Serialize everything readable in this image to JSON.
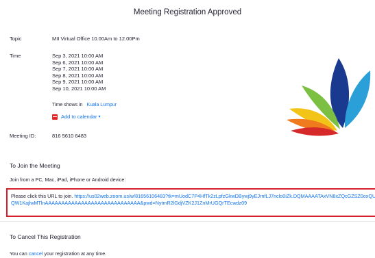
{
  "header": {
    "title": "Meeting Registration Approved"
  },
  "topic": {
    "label": "Topic",
    "value": "MII Virtual Office 10.00Am to 12.00Pm"
  },
  "time": {
    "label": "Time",
    "slots": [
      "Sep 3, 2021 10:00 AM",
      "Sep 6, 2021 10:00 AM",
      "Sep 7, 2021 10:00 AM",
      "Sep 8, 2021 10:00 AM",
      "Sep 9, 2021 10:00 AM",
      "Sep 10, 2021 10:00 AM"
    ],
    "timezone_prefix": "Time shows in",
    "timezone": "Kuala Lumpur",
    "add_calendar": "Add to calendar"
  },
  "meeting_id": {
    "label": "Meeting ID:",
    "value": "816 5610 6483"
  },
  "join": {
    "heading": "To Join the Meeting",
    "subtext": "Join from a PC, Mac, iPad, iPhone or Android device:",
    "url_prefix": "Please click this URL to join.",
    "url": "https://us02web.zoom.us/w/81656106483?tk=mUodC7P4HfTk2zLpfzGkwDBywj9yEJrnfLJ7nclo0iZk.DQMAAAATAxVN8xZQcGZSZ0oxQUwYUhmQW1KajlwMTlnAAAAAAAAAAAAAAAAAAAAAAAAAAAAA&pwd=NytmR2lGdjVZK2J1ZnMrUGQrTEcwdz09"
  },
  "cancel": {
    "heading": "To Cancel This Registration",
    "text_before": "You can",
    "link": "cancel",
    "text_after": "your registration at any time."
  },
  "logo": {
    "colors": [
      "#1a3a8f",
      "#2a9fd8",
      "#7cc043",
      "#f2c418",
      "#f07b1e",
      "#d62a2a"
    ]
  }
}
